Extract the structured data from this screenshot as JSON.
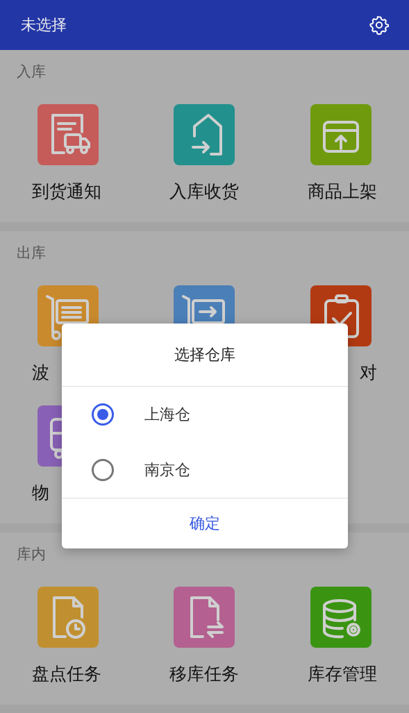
{
  "app_bar": {
    "title": "未选择"
  },
  "sections": [
    {
      "title": "入库",
      "items": [
        {
          "label": "到货通知",
          "color": "#c55c5a"
        },
        {
          "label": "入库收货",
          "color": "#22918e"
        },
        {
          "label": "商品上架",
          "color": "#6f9a0e"
        }
      ]
    },
    {
      "title": "出库",
      "items": [
        {
          "label": "波",
          "color": "#c98a2e"
        },
        {
          "color": "#4b7fb7"
        },
        {
          "label": "对",
          "color": "#b23a12"
        },
        {
          "label": "物",
          "color": "#8860b5"
        }
      ]
    },
    {
      "title": "库内",
      "items": [
        {
          "label": "盘点任务",
          "color": "#c09030"
        },
        {
          "label": "移库任务",
          "color": "#b46090"
        },
        {
          "label": "库存管理",
          "color": "#3a9412"
        }
      ]
    }
  ],
  "dialog": {
    "title": "选择仓库",
    "options": [
      {
        "label": "上海仓",
        "selected": true
      },
      {
        "label": "南京仓",
        "selected": false
      }
    ],
    "button": "确定"
  }
}
